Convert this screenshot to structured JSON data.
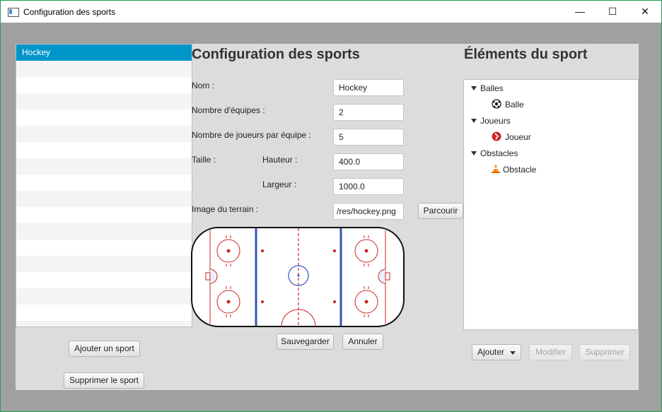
{
  "window": {
    "title": "Configuration des sports",
    "controls": {
      "minimize": "—",
      "maximize": "☐",
      "close": "✕"
    }
  },
  "sport_list": {
    "items": [
      "Hockey"
    ],
    "selected_index": 0,
    "add_button": "Ajouter un sport",
    "delete_button": "Supprimer le sport"
  },
  "config": {
    "heading": "Configuration des sports",
    "name_label": "Nom :",
    "name_value": "Hockey",
    "teams_label": "Nombre d'équipes :",
    "teams_value": "2",
    "players_label": "Nombre de joueurs par équipe :",
    "players_value": "5",
    "size_label": "Taille :",
    "height_label": "Hauteur :",
    "height_value": "400.0",
    "width_label": "Largeur :",
    "width_value": "1000.0",
    "image_label": "Image du terrain :",
    "image_value": "/res/hockey.png",
    "browse_button": "Parcourir",
    "save_button": "Sauvegarder",
    "cancel_button": "Annuler"
  },
  "elements": {
    "heading": "Éléments du sport",
    "groups": [
      {
        "label": "Balles",
        "child": "Balle",
        "icon": "ball-icon"
      },
      {
        "label": "Joueurs",
        "child": "Joueur",
        "icon": "player-icon"
      },
      {
        "label": "Obstacles",
        "child": "Obstacle",
        "icon": "cone-icon"
      }
    ],
    "add_button": "Ajouter",
    "modify_button": "Modifier",
    "delete_button": "Supprimer"
  },
  "colors": {
    "selection": "#0096c9",
    "rink_red": "#cc2222",
    "rink_blue": "#3355bb"
  }
}
